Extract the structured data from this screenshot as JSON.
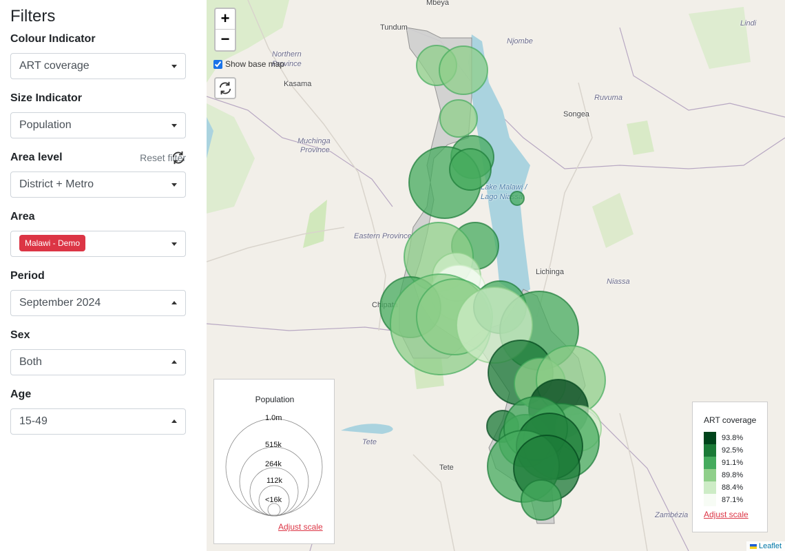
{
  "sidebar": {
    "title": "Filters",
    "colour_indicator": {
      "label": "Colour Indicator",
      "value": "ART coverage"
    },
    "size_indicator": {
      "label": "Size Indicator",
      "value": "Population"
    },
    "area_level": {
      "label": "Area level",
      "value": "District + Metro",
      "reset_label": "Reset filter"
    },
    "area": {
      "label": "Area",
      "value": "Malawi - Demo"
    },
    "period": {
      "label": "Period",
      "value": "September 2024"
    },
    "sex": {
      "label": "Sex",
      "value": "Both"
    },
    "age": {
      "label": "Age",
      "value": "15-49"
    }
  },
  "map": {
    "show_base_map_label": "Show base map",
    "show_base_map_checked": true,
    "zoom_in": "+",
    "zoom_out": "−",
    "places": {
      "mbeya": "Mbeya",
      "tundum": "Tundum",
      "njombe": "Njombe",
      "lindi": "Lindi",
      "northern_province_1": "Northern",
      "northern_province_2": "Province",
      "kasama": "Kasama",
      "ruvuma": "Ruvuma",
      "songea": "Songea",
      "muchinga_1": "Muchinga",
      "muchinga_2": "Province",
      "lake_malawi_1": "Lake Malawi /",
      "lake_malawi_2": "Lago Niassa",
      "eastern_province": "Eastern Province",
      "lichinga": "Lichinga",
      "niassa": "Niassa",
      "chipata": "Chipata",
      "tete_region": "Tete",
      "tete_city": "Tete",
      "zambezia": "Zambézia"
    },
    "colours": {
      "land": "#f2efe9",
      "water": "#aad3df",
      "malawi": "#cfcfcf",
      "park": "#c8e6b0"
    }
  },
  "size_legend": {
    "title": "Population",
    "levels": [
      "1.0m",
      "515k",
      "264k",
      "112k",
      "<16k"
    ],
    "adjust_label": "Adjust scale"
  },
  "colour_legend": {
    "title": "ART coverage",
    "items": [
      {
        "label": "93.8%",
        "color": "#00441b"
      },
      {
        "label": "92.5%",
        "color": "#1b7a37"
      },
      {
        "label": "91.1%",
        "color": "#45ab5d"
      },
      {
        "label": "89.8%",
        "color": "#8fcf8a"
      },
      {
        "label": "88.4%",
        "color": "#cdecc6"
      },
      {
        "label": "87.1%",
        "color": "#f7fcf5"
      }
    ],
    "adjust_label": "Adjust scale"
  },
  "attribution": "Leaflet"
}
